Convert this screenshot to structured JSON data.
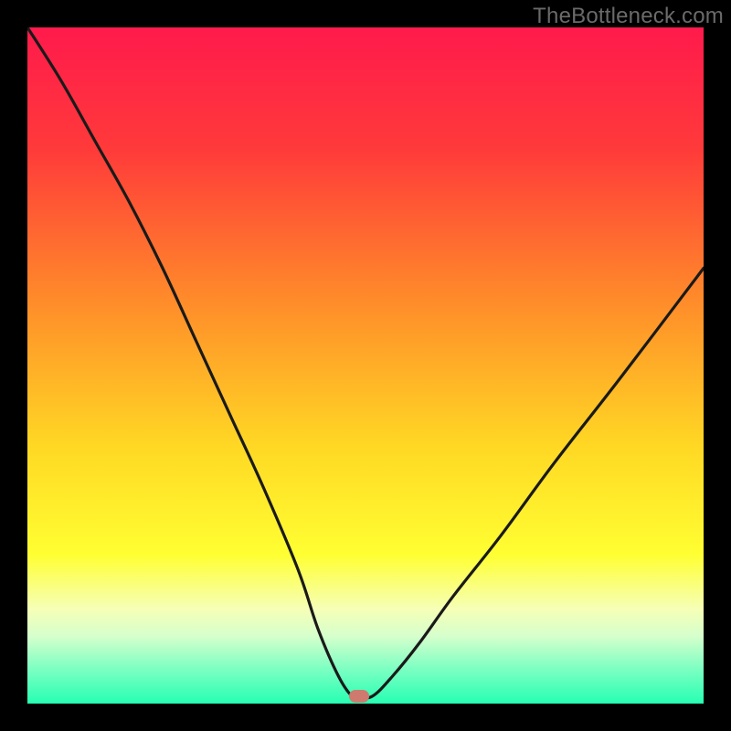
{
  "attribution": "TheBottleneck.com",
  "colors": {
    "marker": "#cf7a6f",
    "curve": "#1a1a1a",
    "gradient_stops": [
      {
        "pct": 0,
        "color": "#ff1a4c"
      },
      {
        "pct": 18,
        "color": "#ff3a3a"
      },
      {
        "pct": 40,
        "color": "#ff8a2a"
      },
      {
        "pct": 62,
        "color": "#ffd824"
      },
      {
        "pct": 78,
        "color": "#ffff32"
      },
      {
        "pct": 86,
        "color": "#f6ffb6"
      },
      {
        "pct": 90,
        "color": "#d6ffcc"
      },
      {
        "pct": 95,
        "color": "#7affc2"
      },
      {
        "pct": 100,
        "color": "#26ffb2"
      }
    ]
  },
  "chart_data": {
    "type": "line",
    "title": "",
    "xlabel": "",
    "ylabel": "",
    "x_range": [
      0,
      100
    ],
    "y_range": [
      0,
      100
    ],
    "note": "V-shaped bottleneck curve; minimum near x≈49. y is bottleneck percentage (lower is better).",
    "series": [
      {
        "name": "bottleneck-curve",
        "x": [
          0,
          5,
          10,
          15,
          20,
          25,
          30,
          35,
          40,
          43,
          46,
          48,
          49,
          51,
          54,
          58,
          63,
          70,
          78,
          88,
          100
        ],
        "y": [
          100,
          92,
          83,
          74,
          64,
          53,
          42,
          31,
          19,
          10,
          3,
          0,
          0,
          0,
          3,
          8,
          15,
          24,
          35,
          48,
          64
        ]
      }
    ],
    "marker": {
      "x": 49,
      "y": 0
    }
  }
}
